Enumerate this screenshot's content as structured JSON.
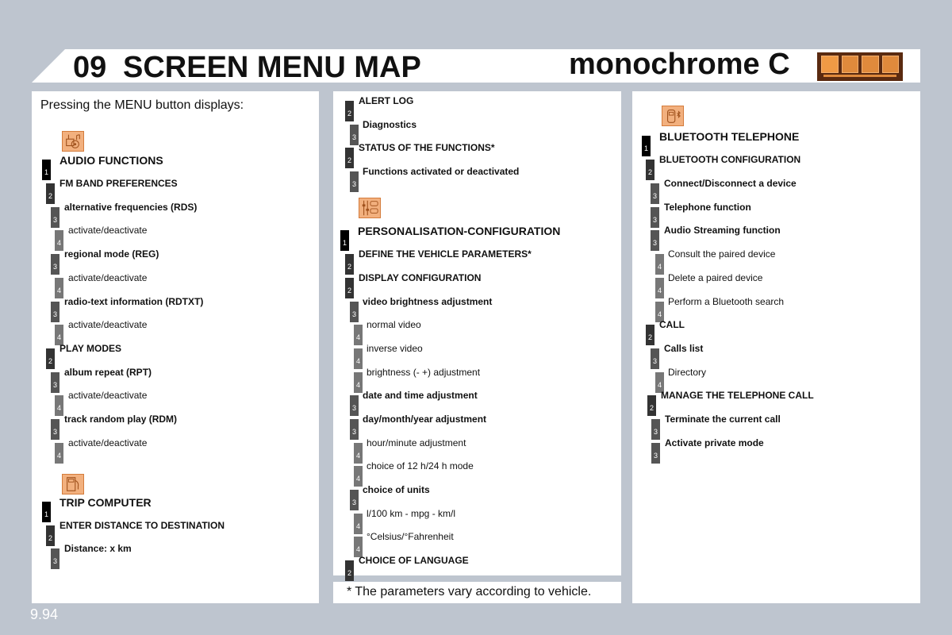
{
  "header": {
    "chapter_number": "09",
    "title": "SCREEN MENU MAP",
    "variant": "monochrome C",
    "icons": [
      "audio-icon",
      "trip-computer-icon",
      "personalisation-icon",
      "bluetooth-telephone-icon"
    ]
  },
  "intro": "Pressing the MENU button displays:",
  "columns": [
    {
      "sections": [
        {
          "icon": "audio-icon",
          "items": [
            {
              "level": "1",
              "label": "AUDIO FUNCTIONS"
            },
            {
              "level": "2",
              "label": "FM BAND PREFERENCES"
            },
            {
              "level": "3",
              "label": "alternative frequencies (RDS)"
            },
            {
              "level": "4",
              "label": "activate/deactivate"
            },
            {
              "level": "3",
              "label": "regional mode (REG)"
            },
            {
              "level": "4",
              "label": "activate/deactivate"
            },
            {
              "level": "3",
              "label": "radio-text information (RDTXT)"
            },
            {
              "level": "4",
              "label": "activate/deactivate"
            },
            {
              "level": "2",
              "label": "PLAY MODES"
            },
            {
              "level": "3",
              "label": "album repeat (RPT)"
            },
            {
              "level": "4",
              "label": "activate/deactivate"
            },
            {
              "level": "3",
              "label": "track random play (RDM)"
            },
            {
              "level": "4",
              "label": "activate/deactivate"
            }
          ]
        },
        {
          "icon": "trip-computer-icon",
          "items": [
            {
              "level": "1",
              "label": "TRIP COMPUTER"
            },
            {
              "level": "2",
              "label": "ENTER DISTANCE TO DESTINATION"
            },
            {
              "level": "3",
              "label": "Distance: x km"
            }
          ]
        }
      ]
    },
    {
      "sections": [
        {
          "items": [
            {
              "level": "2",
              "label": "ALERT LOG"
            },
            {
              "level": "3",
              "label": "Diagnostics"
            },
            {
              "level": "2",
              "label": "STATUS OF THE FUNCTIONS*"
            },
            {
              "level": "3",
              "label": "Functions activated or deactivated"
            }
          ]
        },
        {
          "icon": "personalisation-icon",
          "items": [
            {
              "level": "1",
              "label": "PERSONALISATION-CONFIGURATION"
            },
            {
              "level": "2",
              "label": "DEFINE THE VEHICLE PARAMETERS*"
            },
            {
              "level": "2",
              "label": "DISPLAY CONFIGURATION"
            },
            {
              "level": "3",
              "label": "video brightness adjustment"
            },
            {
              "level": "4",
              "label": "normal video"
            },
            {
              "level": "4",
              "label": "inverse video"
            },
            {
              "level": "4",
              "label": "brightness (- +) adjustment"
            },
            {
              "level": "3",
              "label": "date and time adjustment"
            },
            {
              "level": "3",
              "label": "day/month/year adjustment"
            },
            {
              "level": "4",
              "label": "hour/minute adjustment"
            },
            {
              "level": "4",
              "label": "choice of 12 h/24 h mode"
            },
            {
              "level": "3",
              "label": "choice of units"
            },
            {
              "level": "4",
              "label": "l/100 km - mpg - km/l"
            },
            {
              "level": "4",
              "label": "°Celsius/°Fahrenheit"
            },
            {
              "level": "2",
              "label": "CHOICE OF LANGUAGE"
            }
          ]
        }
      ],
      "footnote": "* The parameters vary according to vehicle."
    },
    {
      "sections": [
        {
          "icon": "bluetooth-telephone-icon",
          "items": [
            {
              "level": "1",
              "label": "BLUETOOTH TELEPHONE"
            },
            {
              "level": "2",
              "label": "BLUETOOTH CONFIGURATION"
            },
            {
              "level": "3",
              "label": "Connect/Disconnect a device"
            },
            {
              "level": "3",
              "label": "Telephone function"
            },
            {
              "level": "3",
              "label": "Audio Streaming function"
            },
            {
              "level": "4",
              "label": "Consult the paired device"
            },
            {
              "level": "4",
              "label": "Delete a paired device"
            },
            {
              "level": "4",
              "label": "Perform a Bluetooth search"
            },
            {
              "level": "2",
              "label": "CALL"
            },
            {
              "level": "3",
              "label": "Calls list"
            },
            {
              "level": "4",
              "label": "Directory"
            },
            {
              "level": "2",
              "label": "MANAGE THE TELEPHONE CALL"
            },
            {
              "level": "3",
              "label": "Terminate the current call"
            },
            {
              "level": "3",
              "label": "Activate private mode"
            }
          ]
        }
      ]
    }
  ],
  "page_number": "9.94",
  "colors": {
    "background": "#bec5cf",
    "icon_fill": "#f2b07e",
    "icon_strip": "#5a2a10"
  }
}
